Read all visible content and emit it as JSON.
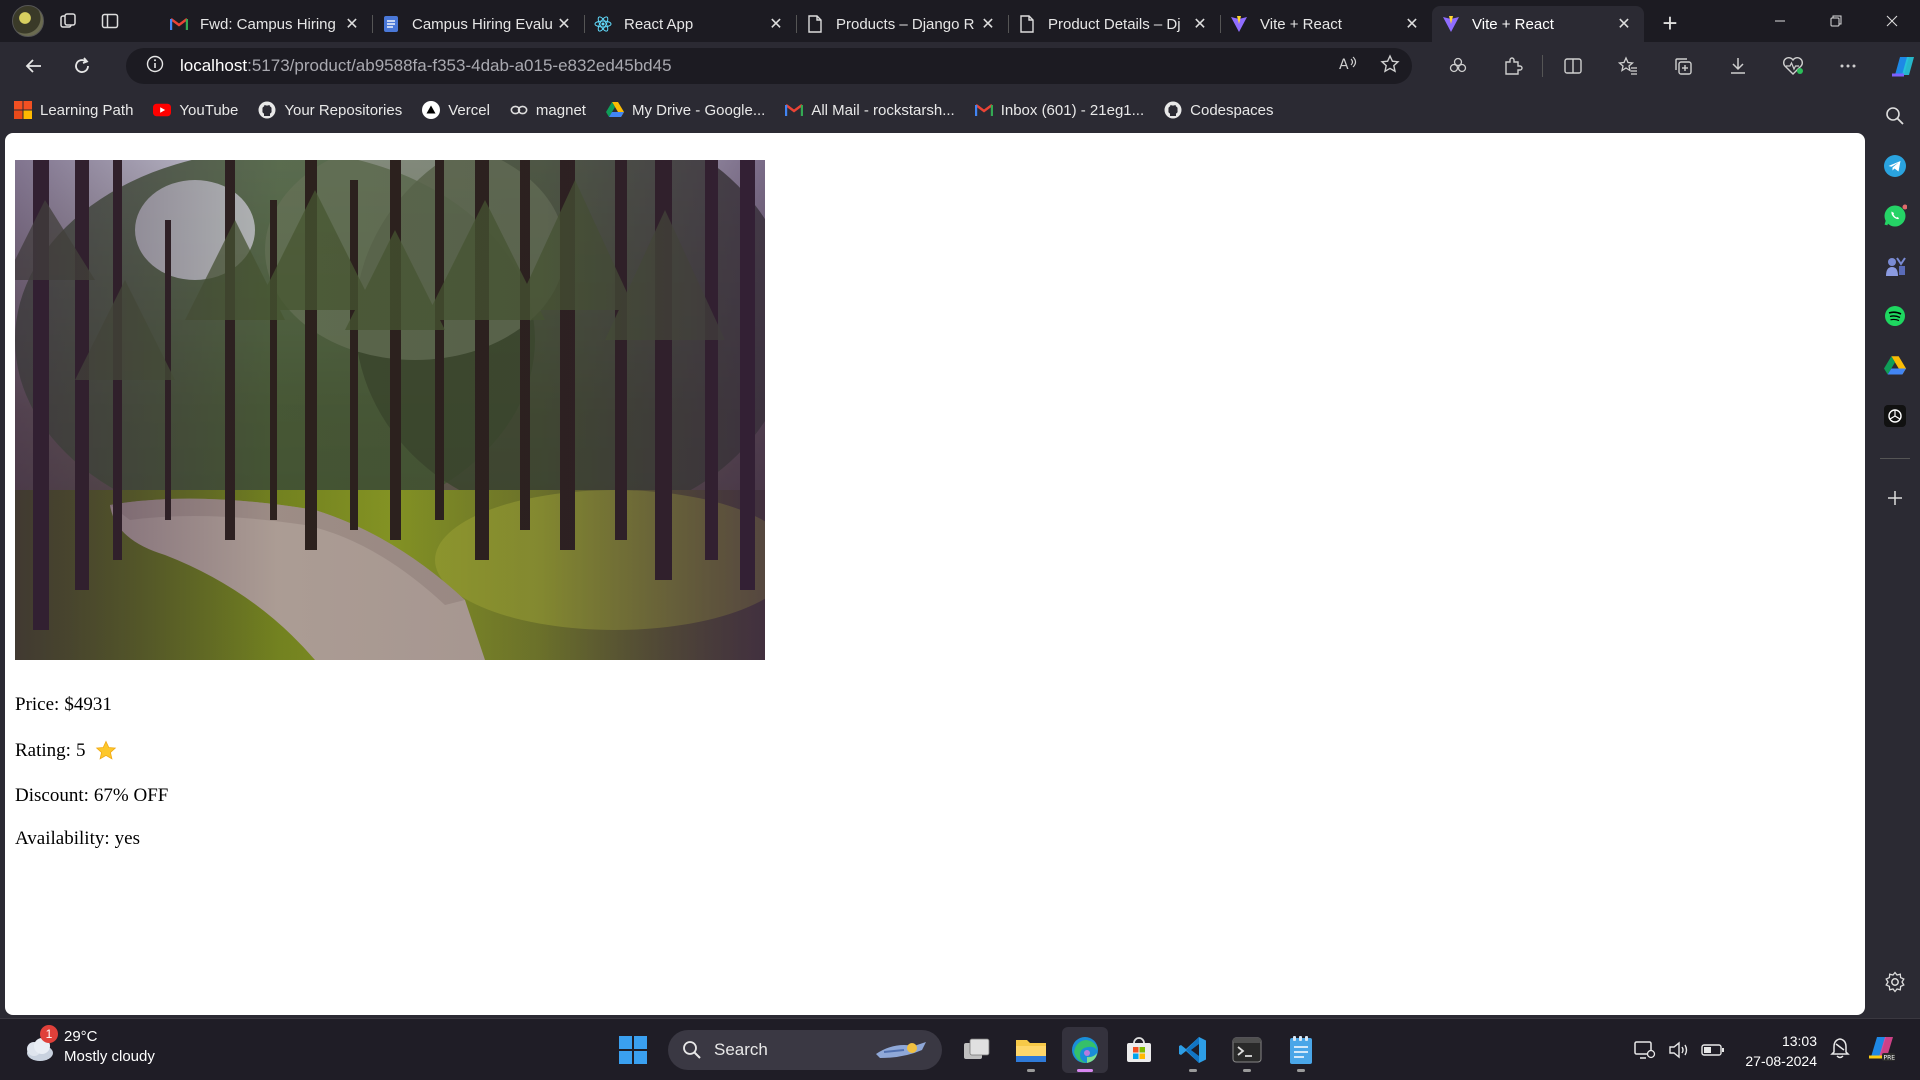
{
  "browser": {
    "tabs": [
      {
        "title": "Fwd: Campus Hiring",
        "favicon": "gmail-icon",
        "active": false
      },
      {
        "title": "Campus Hiring Evalu",
        "favicon": "docs-icon",
        "active": false
      },
      {
        "title": "React App",
        "favicon": "react-icon",
        "active": false
      },
      {
        "title": "Products – Django R",
        "favicon": "page-icon",
        "active": false
      },
      {
        "title": "Product Details – Dj",
        "favicon": "page-icon",
        "active": false
      },
      {
        "title": "Vite + React",
        "favicon": "vite-icon",
        "active": false
      },
      {
        "title": "Vite + React",
        "favicon": "vite-icon",
        "active": true
      }
    ],
    "tab_close_glyph": "✕",
    "new_tab_glyph": "+",
    "address": {
      "host": "localhost",
      "path": ":5173/product/ab9588fa-f353-4dab-a015-e832ed45bd45"
    },
    "favorites": [
      {
        "label": "Learning Path",
        "icon": "learning-path-icon"
      },
      {
        "label": "YouTube",
        "icon": "youtube-icon"
      },
      {
        "label": "Your Repositories",
        "icon": "github-icon"
      },
      {
        "label": "Vercel",
        "icon": "vercel-icon"
      },
      {
        "label": "magnet",
        "icon": "magnet-icon"
      },
      {
        "label": "My Drive - Google...",
        "icon": "google-drive-icon"
      },
      {
        "label": "All Mail - rockstarsh...",
        "icon": "gmail-icon"
      },
      {
        "label": "Inbox (601) - 21eg1...",
        "icon": "gmail-icon"
      },
      {
        "label": "Codespaces",
        "icon": "github-icon"
      }
    ]
  },
  "product": {
    "image_alt": "forest path",
    "price_label": "Price:",
    "price_value": "$4931",
    "rating_label": "Rating:",
    "rating_value": "5",
    "discount_label": "Discount:",
    "discount_value": "67% OFF",
    "availability_label": "Availability:",
    "availability_value": "yes"
  },
  "taskbar": {
    "weather_temp": "29°C",
    "weather_desc": "Mostly cloudy",
    "weather_badge": "1",
    "search_label": "Search",
    "time": "13:03",
    "date": "27-08-2024"
  },
  "colors": {
    "accent_edge": "#3b82f6",
    "page_bg": "#ffffff",
    "chrome_bg": "#2b2a33"
  }
}
